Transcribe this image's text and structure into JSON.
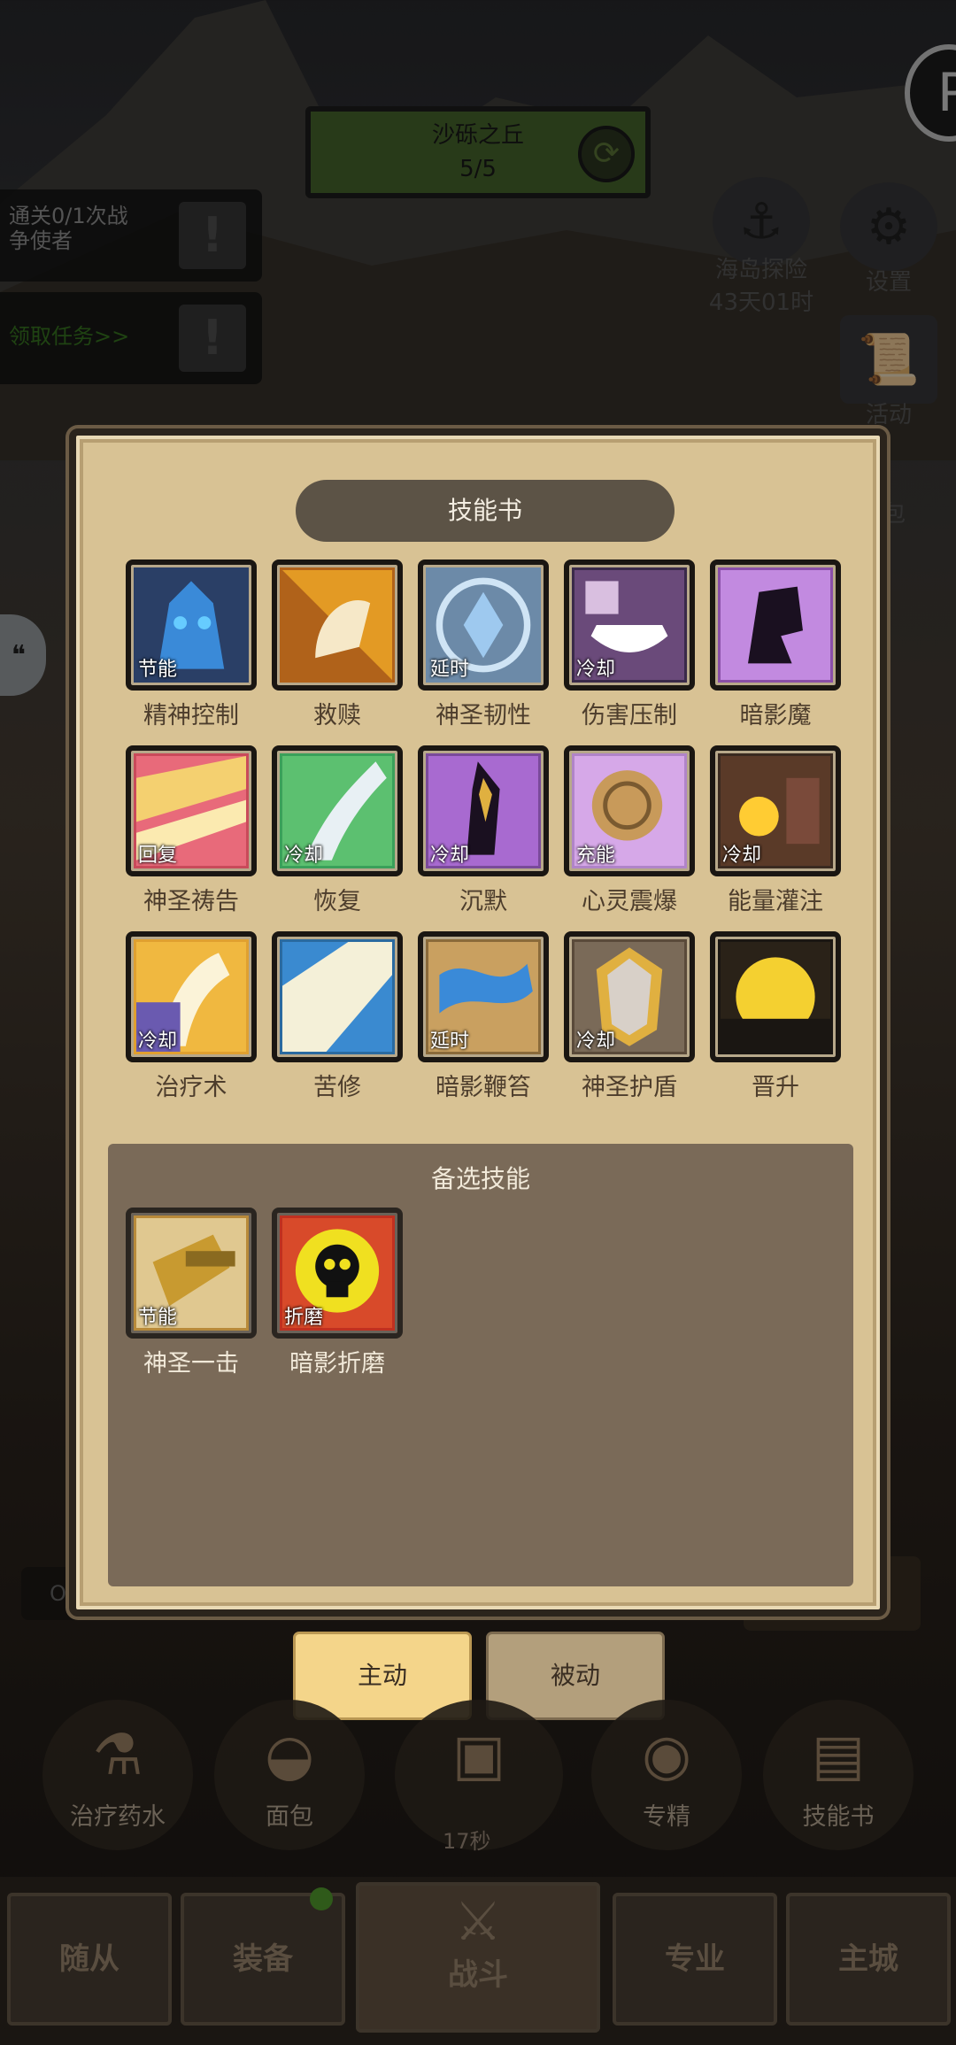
{
  "stage": {
    "name": "沙砾之丘",
    "progress": "5/5"
  },
  "quests": [
    {
      "line1": "通关0/1次战",
      "line2": "争使者"
    },
    {
      "line1": "领取任务>>",
      "line2": ""
    }
  ],
  "right_icons": {
    "island": {
      "label": "海岛探险",
      "sub": "43天01时"
    },
    "settings": {
      "label": "设置"
    },
    "activity": {
      "label": "活动"
    },
    "bag_fragment": "包"
  },
  "panel": {
    "title": "技能书",
    "alt_title": "备选技能",
    "skills": [
      {
        "name": "精神控制",
        "tag": "节能"
      },
      {
        "name": "救赎",
        "tag": ""
      },
      {
        "name": "神圣韧性",
        "tag": "延时"
      },
      {
        "name": "伤害压制",
        "tag": "冷却"
      },
      {
        "name": "暗影魔",
        "tag": ""
      },
      {
        "name": "神圣祷告",
        "tag": "回复"
      },
      {
        "name": "恢复",
        "tag": "冷却"
      },
      {
        "name": "沉默",
        "tag": "冷却"
      },
      {
        "name": "心灵震爆",
        "tag": "充能"
      },
      {
        "name": "能量灌注",
        "tag": "冷却"
      },
      {
        "name": "治疗术",
        "tag": "冷却"
      },
      {
        "name": "苦修",
        "tag": ""
      },
      {
        "name": "暗影鞭笞",
        "tag": "延时"
      },
      {
        "name": "神圣护盾",
        "tag": "冷却"
      },
      {
        "name": "晋升",
        "tag": ""
      }
    ],
    "alt_skills": [
      {
        "name": "神圣一击",
        "tag": "节能"
      },
      {
        "name": "暗影折磨",
        "tag": "折磨"
      }
    ]
  },
  "mode_tabs": {
    "active": "主动",
    "passive": "被动"
  },
  "items": [
    {
      "label": "治疗药水"
    },
    {
      "label": "面包"
    },
    {
      "label": ""
    },
    {
      "label": "专精"
    },
    {
      "label": "技能书"
    }
  ],
  "timer": "17秒",
  "nav": {
    "followers": "随从",
    "equipment": "装备",
    "battle": "战斗",
    "specialty": "专业",
    "city": "主城"
  },
  "bottom_bar_text": "O",
  "colors": {
    "panel_bg": "#d8c294",
    "panel_border": "#2b241c",
    "active_tab": "#f4d58a",
    "alt_area": "#7a6a58"
  }
}
